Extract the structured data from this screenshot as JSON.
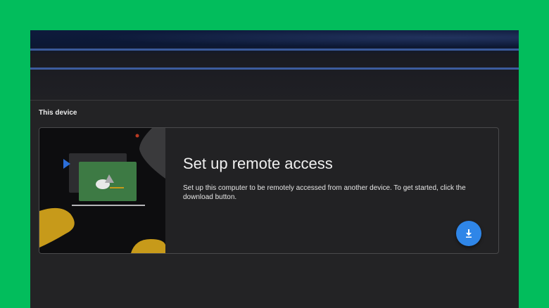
{
  "section": {
    "title": "This device"
  },
  "card": {
    "title": "Set up remote access",
    "description": "Set up this computer to be remotely accessed from another device. To get started, click the download button.",
    "download_icon": "download-icon"
  },
  "colors": {
    "background": "#02bd5c",
    "surface": "#232325",
    "accent": "#2f86e8",
    "illustration_green": "#3d7a44",
    "illustration_yellow": "#c79a1a"
  }
}
